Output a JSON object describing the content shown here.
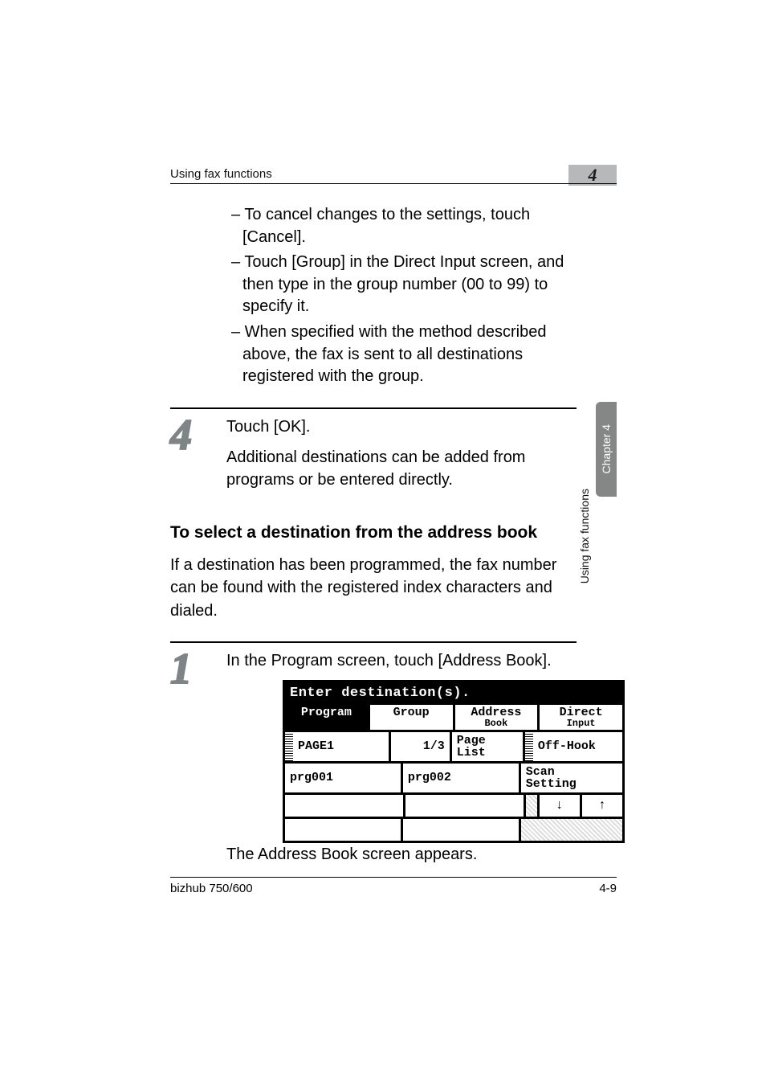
{
  "runhead": {
    "title": "Using fax functions",
    "chapter_num": "4"
  },
  "sidetab": {
    "label": "Chapter 4"
  },
  "sidetext": "Using fax functions",
  "bullets": {
    "b1": "– To cancel changes to the settings, touch [Cancel].",
    "b2": "– Touch [Group] in the Direct Input screen, and then type in the group number (00 to 99) to specify it.",
    "b3": "– When specified with the method described above, the fax is sent to all destinations registered with the group."
  },
  "step4": {
    "num": "4",
    "line1": "Touch [OK].",
    "line2": "Additional destinations can be added from programs or be entered directly."
  },
  "heading": "To select a destination from the address book",
  "intro": "If a destination has been programmed, the fax number can be found with the registered index characters and dialed.",
  "step1": {
    "num": "1",
    "line1": "In the Program screen, touch [Address Book].",
    "after": "The Address Book screen appears."
  },
  "fax": {
    "title": "Enter destination(s).",
    "tabs": {
      "program": "Program",
      "group": "Group",
      "address_l1": "Address",
      "address_l2": "Book",
      "direct_l1": "Direct",
      "direct_l2": "Input"
    },
    "row1": {
      "page_label": "PAGE1",
      "counter": "1/3",
      "pagelist_l1": "Page",
      "pagelist_l2": "List",
      "offhook": "Off-Hook"
    },
    "row2": {
      "prg1": "prg001",
      "prg2": "prg002",
      "scan_l1": "Scan",
      "scan_l2": "Setting"
    },
    "arrows": {
      "down": "↓",
      "up": "↑"
    }
  },
  "footer": {
    "left": "bizhub 750/600",
    "right": "4-9"
  }
}
